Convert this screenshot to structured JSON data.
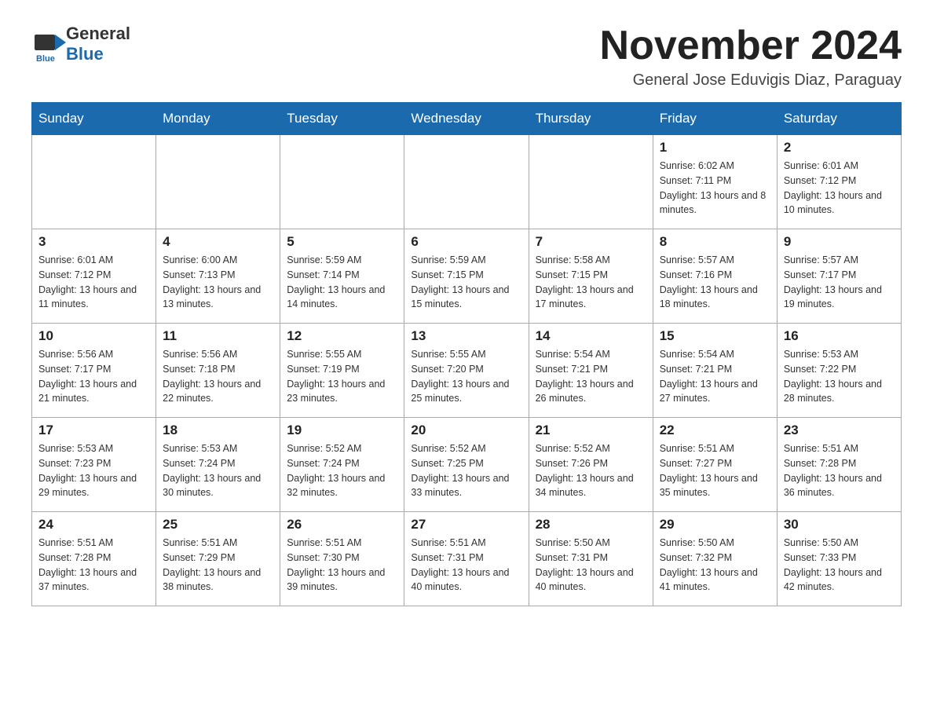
{
  "header": {
    "logo_text_general": "General",
    "logo_text_blue": "Blue",
    "month_title": "November 2024",
    "subtitle": "General Jose Eduvigis Diaz, Paraguay"
  },
  "weekdays": [
    "Sunday",
    "Monday",
    "Tuesday",
    "Wednesday",
    "Thursday",
    "Friday",
    "Saturday"
  ],
  "weeks": [
    [
      {
        "day": "",
        "info": ""
      },
      {
        "day": "",
        "info": ""
      },
      {
        "day": "",
        "info": ""
      },
      {
        "day": "",
        "info": ""
      },
      {
        "day": "",
        "info": ""
      },
      {
        "day": "1",
        "info": "Sunrise: 6:02 AM\nSunset: 7:11 PM\nDaylight: 13 hours and 8 minutes."
      },
      {
        "day": "2",
        "info": "Sunrise: 6:01 AM\nSunset: 7:12 PM\nDaylight: 13 hours and 10 minutes."
      }
    ],
    [
      {
        "day": "3",
        "info": "Sunrise: 6:01 AM\nSunset: 7:12 PM\nDaylight: 13 hours and 11 minutes."
      },
      {
        "day": "4",
        "info": "Sunrise: 6:00 AM\nSunset: 7:13 PM\nDaylight: 13 hours and 13 minutes."
      },
      {
        "day": "5",
        "info": "Sunrise: 5:59 AM\nSunset: 7:14 PM\nDaylight: 13 hours and 14 minutes."
      },
      {
        "day": "6",
        "info": "Sunrise: 5:59 AM\nSunset: 7:15 PM\nDaylight: 13 hours and 15 minutes."
      },
      {
        "day": "7",
        "info": "Sunrise: 5:58 AM\nSunset: 7:15 PM\nDaylight: 13 hours and 17 minutes."
      },
      {
        "day": "8",
        "info": "Sunrise: 5:57 AM\nSunset: 7:16 PM\nDaylight: 13 hours and 18 minutes."
      },
      {
        "day": "9",
        "info": "Sunrise: 5:57 AM\nSunset: 7:17 PM\nDaylight: 13 hours and 19 minutes."
      }
    ],
    [
      {
        "day": "10",
        "info": "Sunrise: 5:56 AM\nSunset: 7:17 PM\nDaylight: 13 hours and 21 minutes."
      },
      {
        "day": "11",
        "info": "Sunrise: 5:56 AM\nSunset: 7:18 PM\nDaylight: 13 hours and 22 minutes."
      },
      {
        "day": "12",
        "info": "Sunrise: 5:55 AM\nSunset: 7:19 PM\nDaylight: 13 hours and 23 minutes."
      },
      {
        "day": "13",
        "info": "Sunrise: 5:55 AM\nSunset: 7:20 PM\nDaylight: 13 hours and 25 minutes."
      },
      {
        "day": "14",
        "info": "Sunrise: 5:54 AM\nSunset: 7:21 PM\nDaylight: 13 hours and 26 minutes."
      },
      {
        "day": "15",
        "info": "Sunrise: 5:54 AM\nSunset: 7:21 PM\nDaylight: 13 hours and 27 minutes."
      },
      {
        "day": "16",
        "info": "Sunrise: 5:53 AM\nSunset: 7:22 PM\nDaylight: 13 hours and 28 minutes."
      }
    ],
    [
      {
        "day": "17",
        "info": "Sunrise: 5:53 AM\nSunset: 7:23 PM\nDaylight: 13 hours and 29 minutes."
      },
      {
        "day": "18",
        "info": "Sunrise: 5:53 AM\nSunset: 7:24 PM\nDaylight: 13 hours and 30 minutes."
      },
      {
        "day": "19",
        "info": "Sunrise: 5:52 AM\nSunset: 7:24 PM\nDaylight: 13 hours and 32 minutes."
      },
      {
        "day": "20",
        "info": "Sunrise: 5:52 AM\nSunset: 7:25 PM\nDaylight: 13 hours and 33 minutes."
      },
      {
        "day": "21",
        "info": "Sunrise: 5:52 AM\nSunset: 7:26 PM\nDaylight: 13 hours and 34 minutes."
      },
      {
        "day": "22",
        "info": "Sunrise: 5:51 AM\nSunset: 7:27 PM\nDaylight: 13 hours and 35 minutes."
      },
      {
        "day": "23",
        "info": "Sunrise: 5:51 AM\nSunset: 7:28 PM\nDaylight: 13 hours and 36 minutes."
      }
    ],
    [
      {
        "day": "24",
        "info": "Sunrise: 5:51 AM\nSunset: 7:28 PM\nDaylight: 13 hours and 37 minutes."
      },
      {
        "day": "25",
        "info": "Sunrise: 5:51 AM\nSunset: 7:29 PM\nDaylight: 13 hours and 38 minutes."
      },
      {
        "day": "26",
        "info": "Sunrise: 5:51 AM\nSunset: 7:30 PM\nDaylight: 13 hours and 39 minutes."
      },
      {
        "day": "27",
        "info": "Sunrise: 5:51 AM\nSunset: 7:31 PM\nDaylight: 13 hours and 40 minutes."
      },
      {
        "day": "28",
        "info": "Sunrise: 5:50 AM\nSunset: 7:31 PM\nDaylight: 13 hours and 40 minutes."
      },
      {
        "day": "29",
        "info": "Sunrise: 5:50 AM\nSunset: 7:32 PM\nDaylight: 13 hours and 41 minutes."
      },
      {
        "day": "30",
        "info": "Sunrise: 5:50 AM\nSunset: 7:33 PM\nDaylight: 13 hours and 42 minutes."
      }
    ]
  ]
}
